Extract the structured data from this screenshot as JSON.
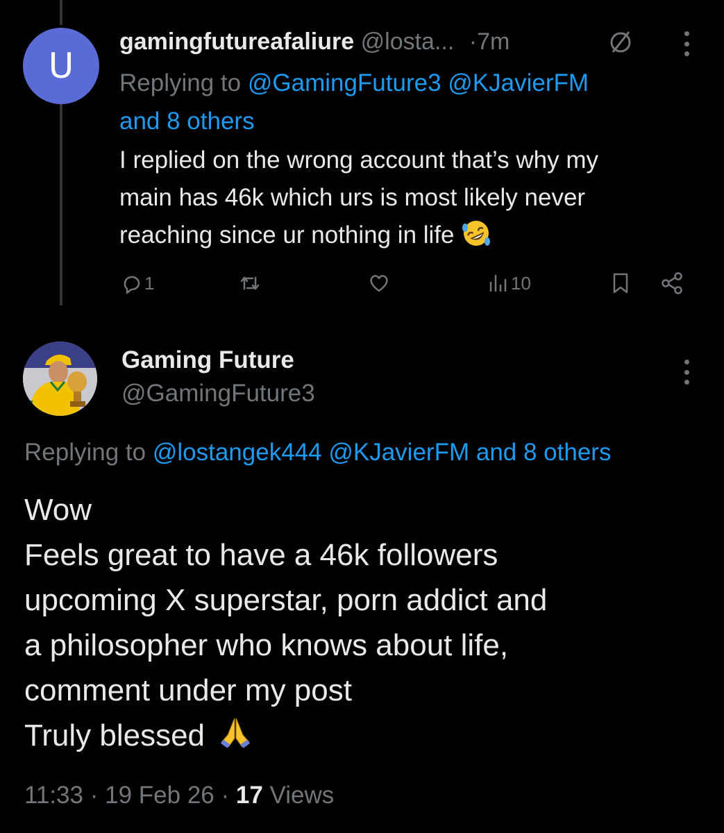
{
  "reply_tweet": {
    "avatar_letter": "U",
    "display_name": "gamingfutureafaliure",
    "handle": "@losta...",
    "time": "·7m",
    "replying_prefix": "Replying to",
    "replying_mentions": [
      "@GamingFuture3",
      "@KJavierFM"
    ],
    "replying_others": "and 8 others",
    "body_lines": [
      "I replied on the wrong account that’s why my",
      "main has 46k which urs is most likely never",
      "reaching since ur nothing in life"
    ],
    "body_emoji": "rolling-on-floor-laughing-emoji",
    "reply_count": "1",
    "views_count": "10"
  },
  "main_tweet": {
    "display_name": "Gaming Future",
    "handle": "@GamingFuture3",
    "replying_prefix": "Replying to",
    "replying_mentions": [
      "@lostangek444",
      "@KJavierFM",
      "and 8 others"
    ],
    "body_lines": [
      "Wow",
      "Feels great to have a 46k followers",
      "upcoming X superstar, porn addict and",
      "a philosopher who knows about life,",
      "comment under my post",
      "Truly blessed"
    ],
    "body_emoji": "folded-hands-emoji",
    "time": "11:33",
    "date": "19 Feb 26",
    "views_count": "17",
    "views_label": "Views",
    "separator": "·"
  },
  "colors": {
    "background": "#000000",
    "text": "#e7e9ea",
    "muted": "#71767b",
    "link": "#1d9bf0",
    "avatar_u_bg": "#5b6bd6"
  }
}
